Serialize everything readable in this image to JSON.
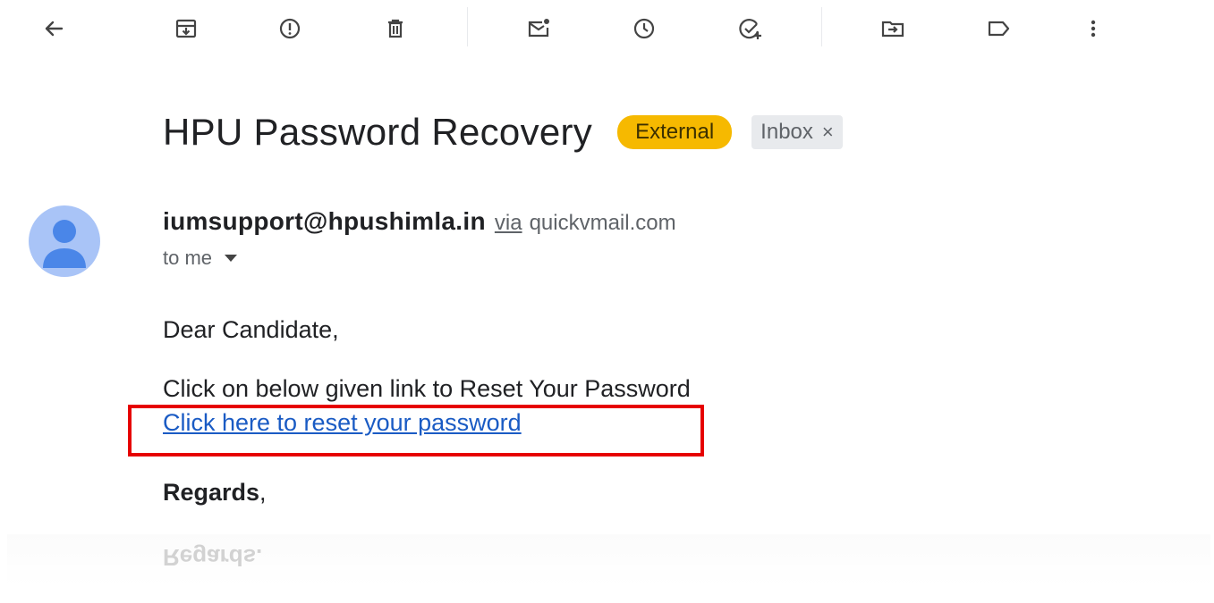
{
  "toolbar": {
    "buttons": [
      {
        "name": "back",
        "icon": "arrow-left-icon"
      },
      {
        "name": "archive",
        "icon": "archive-icon"
      },
      {
        "name": "report-spam",
        "icon": "report-spam-icon"
      },
      {
        "name": "delete",
        "icon": "trash-icon"
      },
      {
        "name": "mark-unread",
        "icon": "mark-unread-icon"
      },
      {
        "name": "snooze",
        "icon": "clock-icon"
      },
      {
        "name": "add-to-tasks",
        "icon": "add-task-icon"
      },
      {
        "name": "move-to",
        "icon": "move-to-folder-icon"
      },
      {
        "name": "labels",
        "icon": "label-icon"
      },
      {
        "name": "more",
        "icon": "more-vert-icon"
      }
    ]
  },
  "email": {
    "subject": "HPU Password Recovery",
    "labels": {
      "external": "External",
      "inbox": "Inbox",
      "inbox_remove": "×"
    },
    "sender": "iumsupport@hpushimla.in",
    "via": "via",
    "via_domain": "quickvmail.com",
    "recipient": "to me",
    "body": {
      "greeting": "Dear Candidate,",
      "instruction": "Click on below given link to Reset Your Password",
      "link_text": "Click here to reset your password",
      "signoff": "Regards",
      "signoff_punct": ","
    },
    "reflection_text": "Regards."
  },
  "colors": {
    "external_label": "#f6b900",
    "inbox_label": "#e8eaed",
    "link": "#1a5bc4",
    "highlight": "#e60000",
    "avatar_bg": "#a9c4f7",
    "avatar_fg": "#4a86e8"
  }
}
